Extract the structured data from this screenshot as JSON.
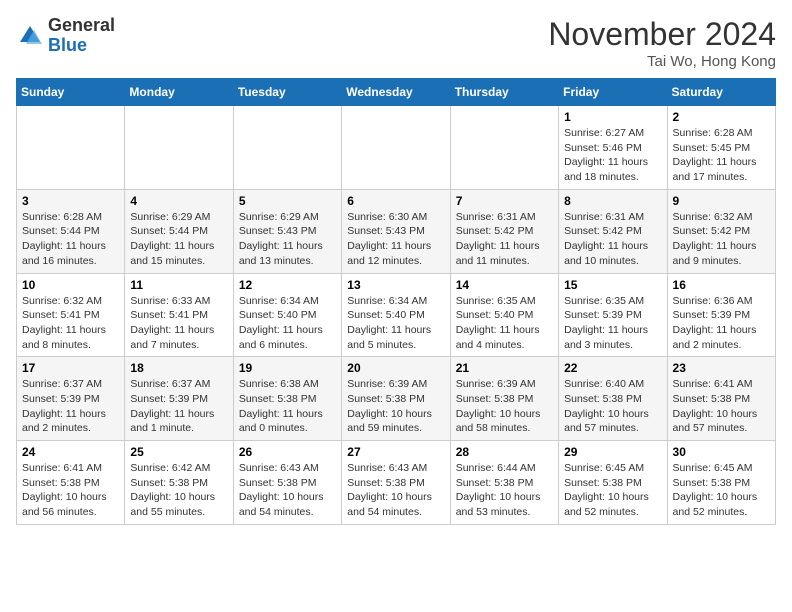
{
  "header": {
    "logo_general": "General",
    "logo_blue": "Blue",
    "month_title": "November 2024",
    "location": "Tai Wo, Hong Kong"
  },
  "days_of_week": [
    "Sunday",
    "Monday",
    "Tuesday",
    "Wednesday",
    "Thursday",
    "Friday",
    "Saturday"
  ],
  "weeks": [
    [
      {
        "day": "",
        "info": ""
      },
      {
        "day": "",
        "info": ""
      },
      {
        "day": "",
        "info": ""
      },
      {
        "day": "",
        "info": ""
      },
      {
        "day": "",
        "info": ""
      },
      {
        "day": "1",
        "info": "Sunrise: 6:27 AM\nSunset: 5:46 PM\nDaylight: 11 hours and 18 minutes."
      },
      {
        "day": "2",
        "info": "Sunrise: 6:28 AM\nSunset: 5:45 PM\nDaylight: 11 hours and 17 minutes."
      }
    ],
    [
      {
        "day": "3",
        "info": "Sunrise: 6:28 AM\nSunset: 5:44 PM\nDaylight: 11 hours and 16 minutes."
      },
      {
        "day": "4",
        "info": "Sunrise: 6:29 AM\nSunset: 5:44 PM\nDaylight: 11 hours and 15 minutes."
      },
      {
        "day": "5",
        "info": "Sunrise: 6:29 AM\nSunset: 5:43 PM\nDaylight: 11 hours and 13 minutes."
      },
      {
        "day": "6",
        "info": "Sunrise: 6:30 AM\nSunset: 5:43 PM\nDaylight: 11 hours and 12 minutes."
      },
      {
        "day": "7",
        "info": "Sunrise: 6:31 AM\nSunset: 5:42 PM\nDaylight: 11 hours and 11 minutes."
      },
      {
        "day": "8",
        "info": "Sunrise: 6:31 AM\nSunset: 5:42 PM\nDaylight: 11 hours and 10 minutes."
      },
      {
        "day": "9",
        "info": "Sunrise: 6:32 AM\nSunset: 5:42 PM\nDaylight: 11 hours and 9 minutes."
      }
    ],
    [
      {
        "day": "10",
        "info": "Sunrise: 6:32 AM\nSunset: 5:41 PM\nDaylight: 11 hours and 8 minutes."
      },
      {
        "day": "11",
        "info": "Sunrise: 6:33 AM\nSunset: 5:41 PM\nDaylight: 11 hours and 7 minutes."
      },
      {
        "day": "12",
        "info": "Sunrise: 6:34 AM\nSunset: 5:40 PM\nDaylight: 11 hours and 6 minutes."
      },
      {
        "day": "13",
        "info": "Sunrise: 6:34 AM\nSunset: 5:40 PM\nDaylight: 11 hours and 5 minutes."
      },
      {
        "day": "14",
        "info": "Sunrise: 6:35 AM\nSunset: 5:40 PM\nDaylight: 11 hours and 4 minutes."
      },
      {
        "day": "15",
        "info": "Sunrise: 6:35 AM\nSunset: 5:39 PM\nDaylight: 11 hours and 3 minutes."
      },
      {
        "day": "16",
        "info": "Sunrise: 6:36 AM\nSunset: 5:39 PM\nDaylight: 11 hours and 2 minutes."
      }
    ],
    [
      {
        "day": "17",
        "info": "Sunrise: 6:37 AM\nSunset: 5:39 PM\nDaylight: 11 hours and 2 minutes."
      },
      {
        "day": "18",
        "info": "Sunrise: 6:37 AM\nSunset: 5:39 PM\nDaylight: 11 hours and 1 minute."
      },
      {
        "day": "19",
        "info": "Sunrise: 6:38 AM\nSunset: 5:38 PM\nDaylight: 11 hours and 0 minutes."
      },
      {
        "day": "20",
        "info": "Sunrise: 6:39 AM\nSunset: 5:38 PM\nDaylight: 10 hours and 59 minutes."
      },
      {
        "day": "21",
        "info": "Sunrise: 6:39 AM\nSunset: 5:38 PM\nDaylight: 10 hours and 58 minutes."
      },
      {
        "day": "22",
        "info": "Sunrise: 6:40 AM\nSunset: 5:38 PM\nDaylight: 10 hours and 57 minutes."
      },
      {
        "day": "23",
        "info": "Sunrise: 6:41 AM\nSunset: 5:38 PM\nDaylight: 10 hours and 57 minutes."
      }
    ],
    [
      {
        "day": "24",
        "info": "Sunrise: 6:41 AM\nSunset: 5:38 PM\nDaylight: 10 hours and 56 minutes."
      },
      {
        "day": "25",
        "info": "Sunrise: 6:42 AM\nSunset: 5:38 PM\nDaylight: 10 hours and 55 minutes."
      },
      {
        "day": "26",
        "info": "Sunrise: 6:43 AM\nSunset: 5:38 PM\nDaylight: 10 hours and 54 minutes."
      },
      {
        "day": "27",
        "info": "Sunrise: 6:43 AM\nSunset: 5:38 PM\nDaylight: 10 hours and 54 minutes."
      },
      {
        "day": "28",
        "info": "Sunrise: 6:44 AM\nSunset: 5:38 PM\nDaylight: 10 hours and 53 minutes."
      },
      {
        "day": "29",
        "info": "Sunrise: 6:45 AM\nSunset: 5:38 PM\nDaylight: 10 hours and 52 minutes."
      },
      {
        "day": "30",
        "info": "Sunrise: 6:45 AM\nSunset: 5:38 PM\nDaylight: 10 hours and 52 minutes."
      }
    ]
  ]
}
